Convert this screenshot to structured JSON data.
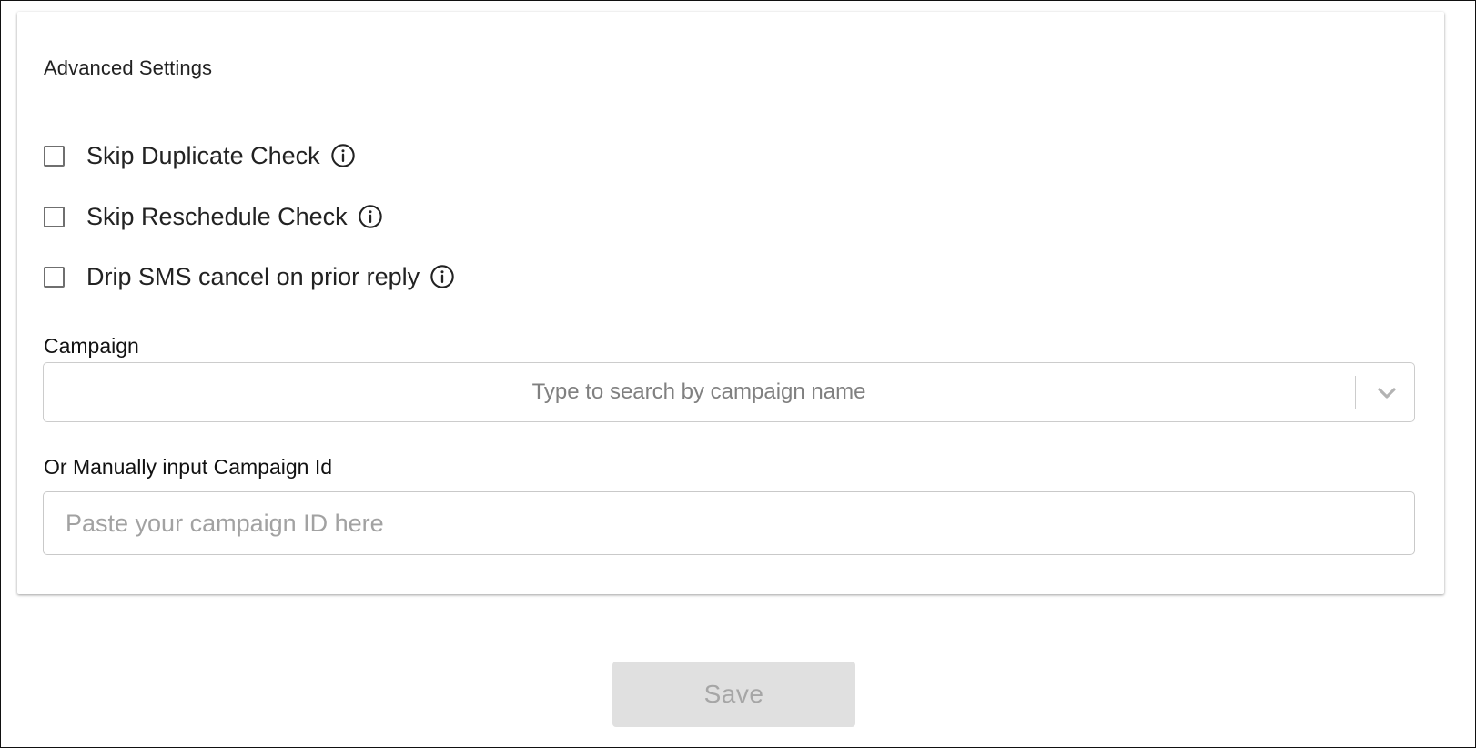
{
  "advanced_settings": {
    "title": "Advanced Settings",
    "options": [
      {
        "label": "Skip Duplicate Check",
        "checked": false,
        "icon": "info-icon"
      },
      {
        "label": "Skip Reschedule Check",
        "checked": false,
        "icon": "info-icon"
      },
      {
        "label": "Drip SMS cancel on prior reply",
        "checked": false,
        "icon": "info-icon"
      }
    ]
  },
  "campaign": {
    "label": "Campaign",
    "placeholder": "Type to search by campaign name",
    "icon": "chevron-down-icon"
  },
  "campaign_id": {
    "label": "Or Manually input Campaign Id",
    "placeholder": "Paste your campaign ID here",
    "value": ""
  },
  "save_button": {
    "label": "Save",
    "disabled": true
  },
  "colors": {
    "text": "#222222",
    "border": "#cccccc",
    "placeholder": "#808080",
    "disabled_button_bg": "#e0e0e0",
    "disabled_button_text": "#a6a6a6"
  }
}
